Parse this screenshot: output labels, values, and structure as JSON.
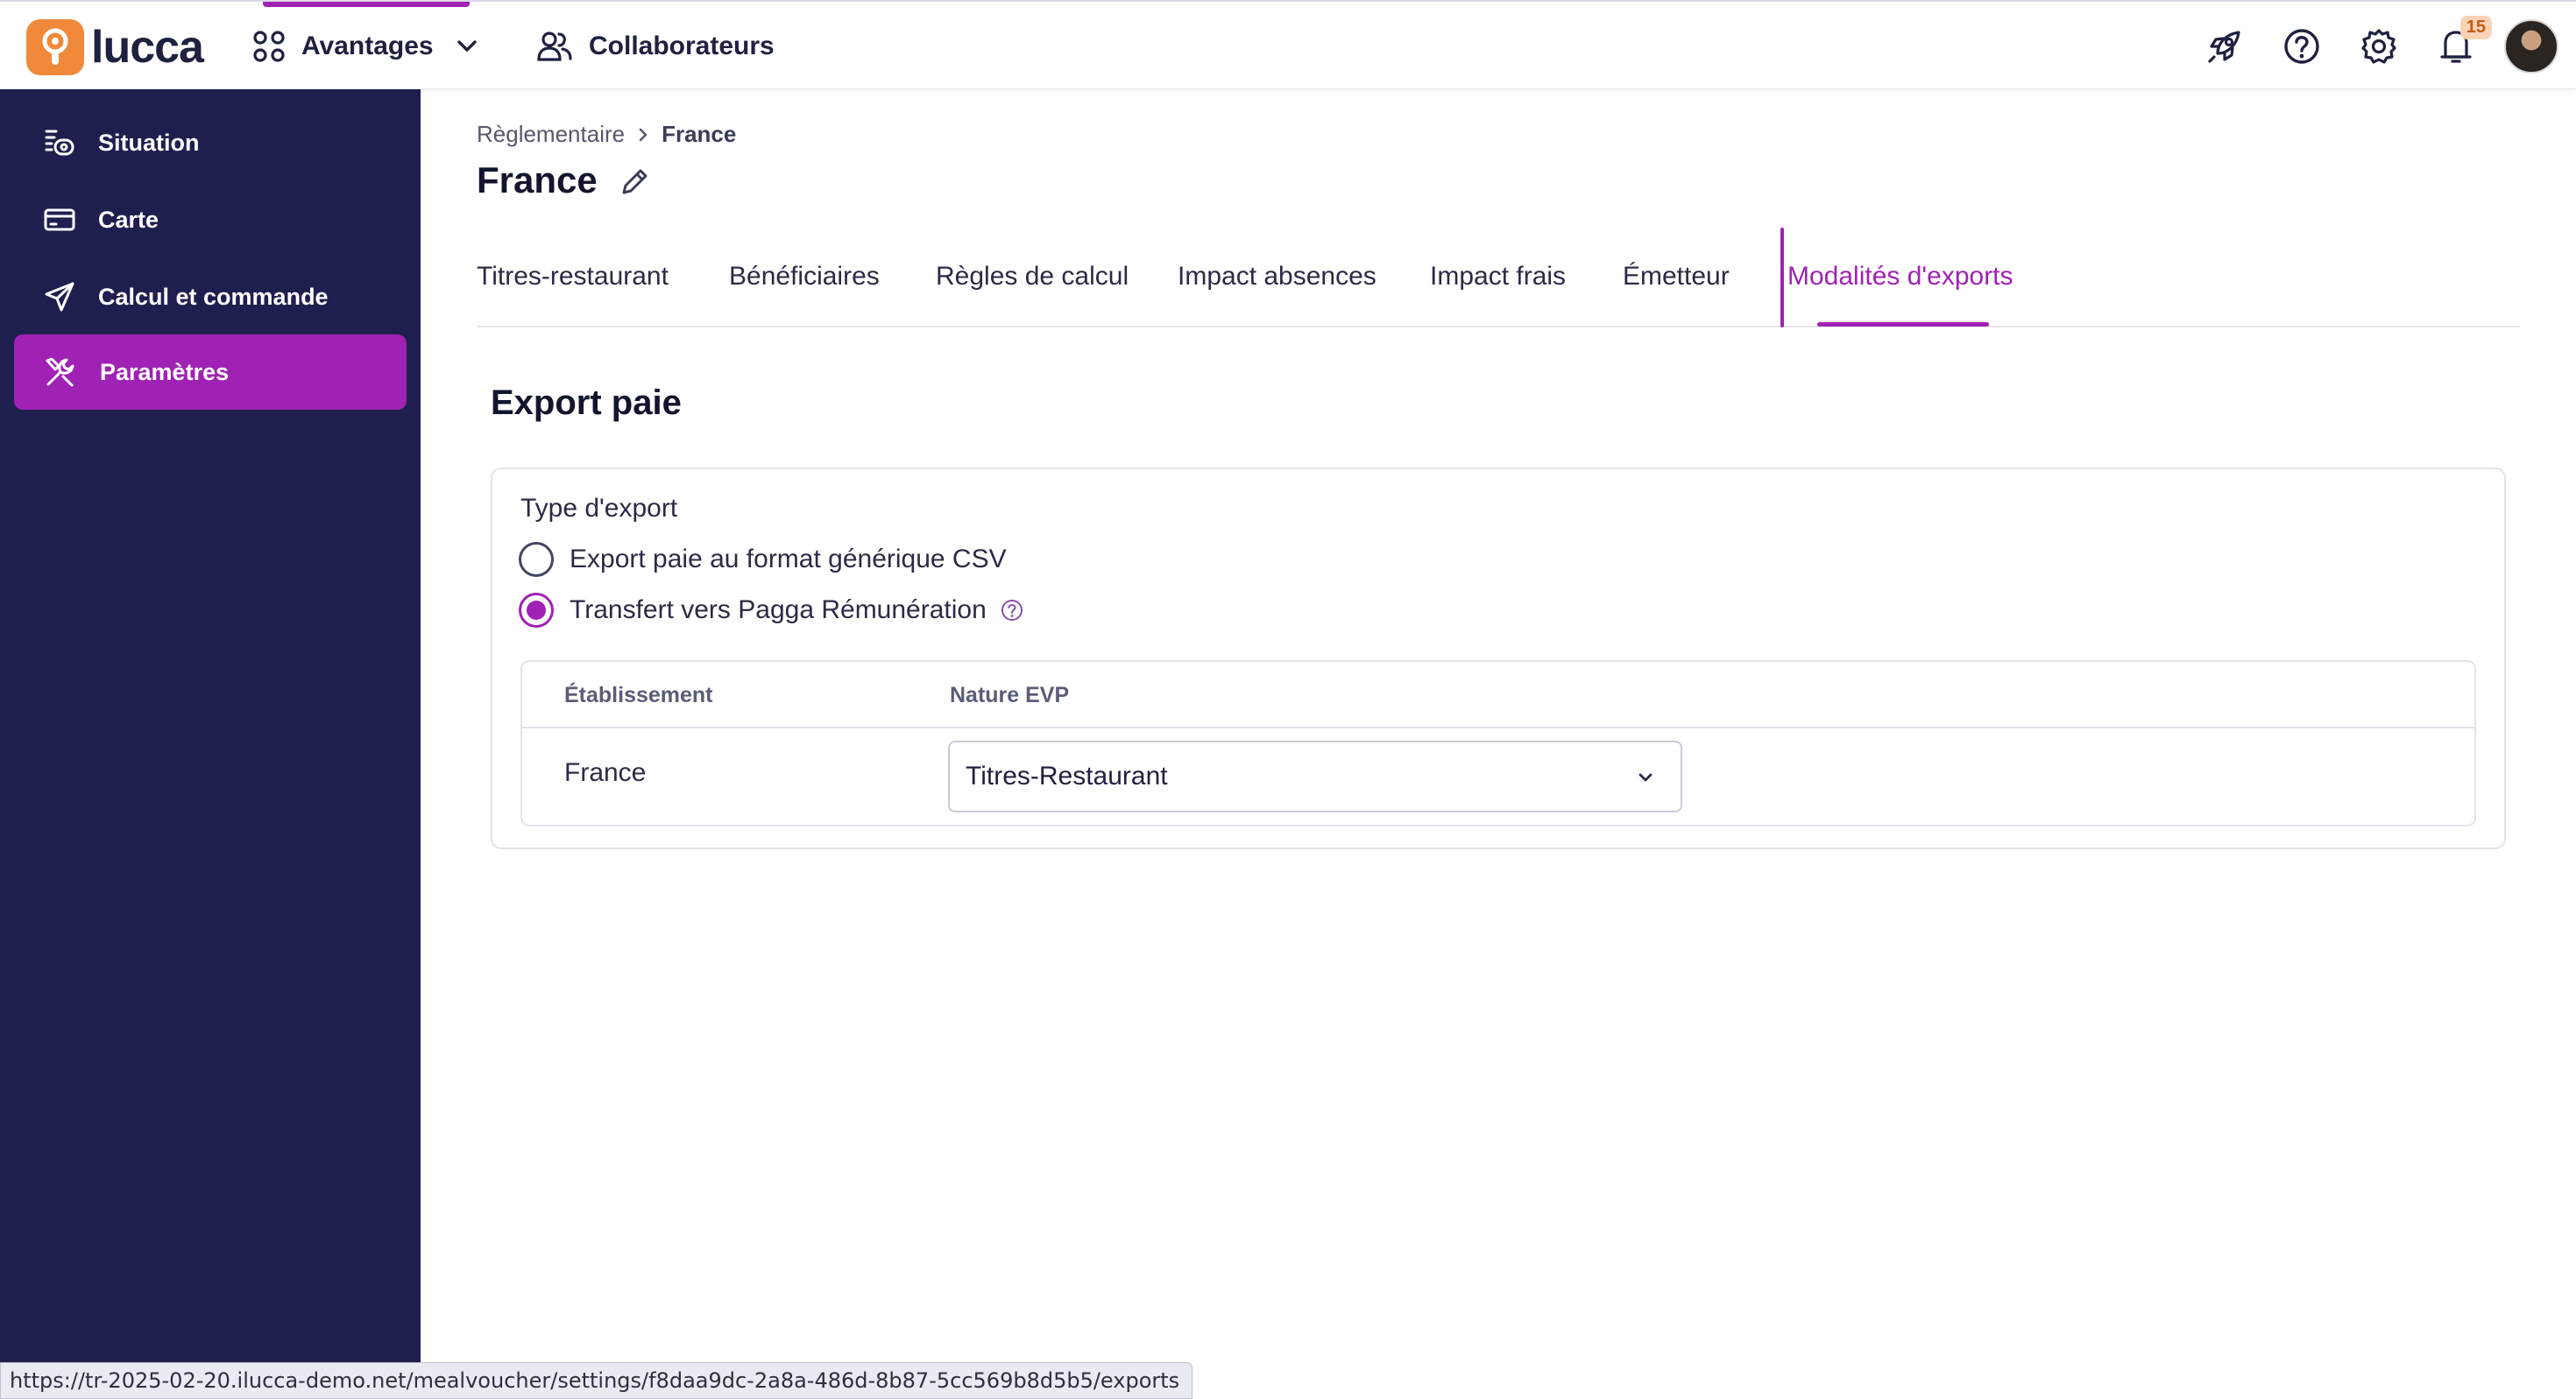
{
  "topbar": {
    "logo_text": "lucca",
    "nav": [
      {
        "label": "Avantages",
        "icon": "apps-grid-icon",
        "has_dropdown": true,
        "active": true
      },
      {
        "label": "Collaborateurs",
        "icon": "users-icon",
        "has_dropdown": false,
        "active": false
      }
    ],
    "icons": [
      "rocket-icon",
      "help-circle-icon",
      "gear-icon",
      "bell-icon"
    ],
    "notifications_count": "15",
    "accent_color": "#a022b4"
  },
  "sidebar": {
    "items": [
      {
        "label": "Situation",
        "icon": "situation-icon",
        "active": false
      },
      {
        "label": "Carte",
        "icon": "card-icon",
        "active": false
      },
      {
        "label": "Calcul et commande",
        "icon": "send-icon",
        "active": false
      },
      {
        "label": "Paramètres",
        "icon": "tools-icon",
        "active": true
      }
    ],
    "background": "#1e1f4e"
  },
  "breadcrumb": {
    "parent": "Règlementaire",
    "current": "France"
  },
  "page": {
    "title": "France"
  },
  "tabs": [
    {
      "label": "Titres-restaurant",
      "active": false
    },
    {
      "label": "Bénéficiaires",
      "active": false
    },
    {
      "label": "Règles de calcul",
      "active": false
    },
    {
      "label": "Impact absences",
      "active": false
    },
    {
      "label": "Impact frais",
      "active": false
    },
    {
      "label": "Émetteur",
      "active": false
    },
    {
      "label": "Modalités d'exports",
      "active": true
    }
  ],
  "export": {
    "section_title": "Export paie",
    "type_label": "Type d'export",
    "options": [
      {
        "label": "Export paie au format générique CSV",
        "checked": false
      },
      {
        "label": "Transfert vers Pagga Rémunération",
        "checked": true
      }
    ],
    "table": {
      "columns": [
        "Établissement",
        "Nature EVP"
      ],
      "rows": [
        {
          "etablissement": "France",
          "nature_evp": "Titres-Restaurant"
        }
      ]
    }
  },
  "status_url": "https://tr-2025-02-20.ilucca-demo.net/mealvoucher/settings/f8daa9dc-2a8a-486d-8b87-5cc569b8d5b5/exports"
}
